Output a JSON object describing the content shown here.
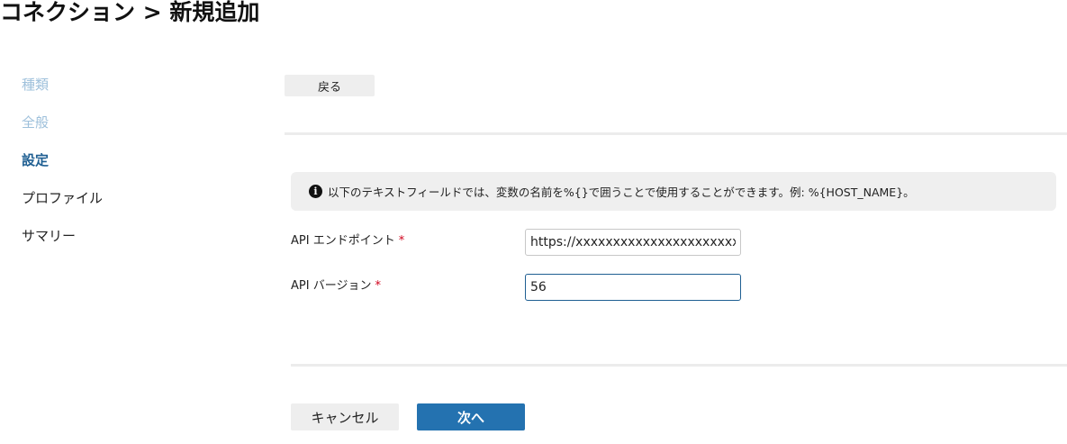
{
  "header": {
    "title": "コネクション > 新規追加"
  },
  "steps": {
    "items": [
      {
        "label": "種類",
        "state": "done"
      },
      {
        "label": "全般",
        "state": "done"
      },
      {
        "label": "設定",
        "state": "current"
      },
      {
        "label": "プロファイル",
        "state": "todo"
      },
      {
        "label": "サマリー",
        "state": "todo"
      }
    ]
  },
  "toolbar": {
    "back_label": "戻る"
  },
  "info": {
    "icon": "info-icon",
    "text": "以下のテキストフィールドでは、変数の名前を%{}で囲うことで使用することができます。例: %{HOST_NAME}。"
  },
  "form": {
    "api_endpoint": {
      "label": "API エンドポイント",
      "required_mark": "*",
      "value": "https://xxxxxxxxxxxxxxxxxxxxxxxxxxxx"
    },
    "api_version": {
      "label": "API バージョン",
      "required_mark": "*",
      "value": "56"
    }
  },
  "footer": {
    "cancel_label": "キャンセル",
    "next_label": "次へ"
  },
  "colors": {
    "accent": "#2472b0",
    "step_current": "#1f5f92",
    "step_done": "#9ec0db",
    "required": "#d0021b"
  }
}
